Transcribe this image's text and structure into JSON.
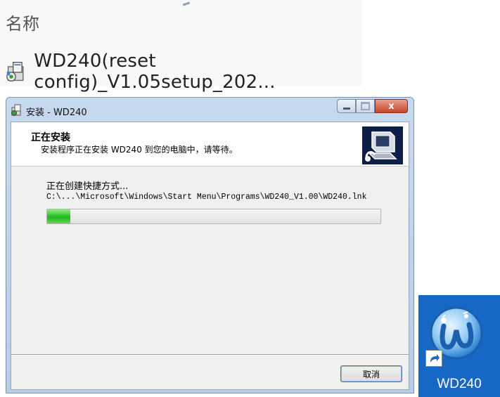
{
  "explorer": {
    "column_header": "名称",
    "file_name": "WD240(reset config)_V1.05setup_202..."
  },
  "window": {
    "title": "安装 - WD240",
    "controls": {
      "close_glyph": "x"
    },
    "header": {
      "title": "正在安装",
      "subtitle": "安装程序正在安装 WD240 到您的电脑中，请等待。"
    },
    "status_text": "正在创建快捷方式...",
    "path_text": "C:\\...\\Microsoft\\Windows\\Start Menu\\Programs\\WD240_V1.00\\WD240.lnk",
    "progress_percent": 7,
    "cancel_label": "取消"
  },
  "desktop": {
    "shortcut_label": "WD240",
    "background_color": "#1767c4"
  }
}
